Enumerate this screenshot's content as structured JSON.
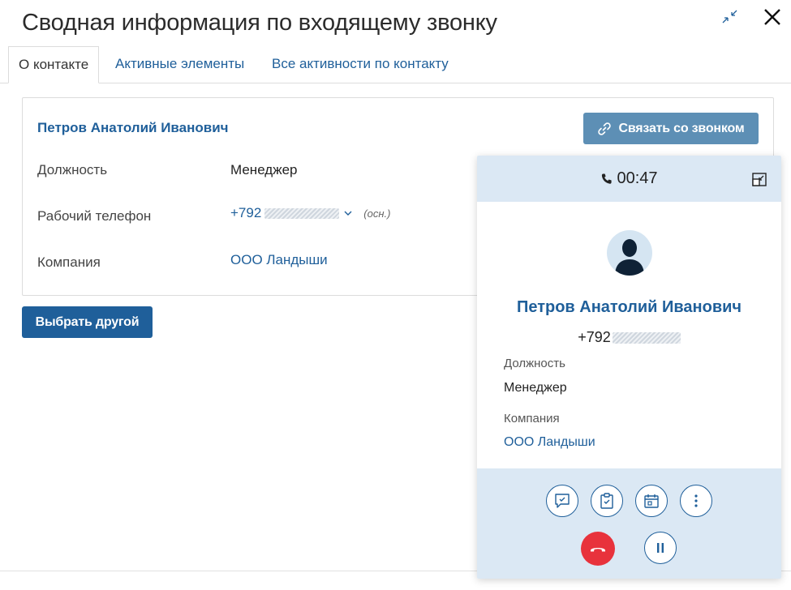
{
  "dialog": {
    "title": "Сводная информация по входящему звонку",
    "collapse_icon": "collapse-arrows-icon",
    "close_icon": "close-icon"
  },
  "tabs": [
    {
      "label": "О контакте",
      "active": true
    },
    {
      "label": "Активные элементы",
      "active": false
    },
    {
      "label": "Все активности по контакту",
      "active": false
    }
  ],
  "contact_card": {
    "name": "Петров Анатолий Иванович",
    "link_button_label": "Связать со звонком",
    "link_button_icon": "link-icon",
    "rows": {
      "position": {
        "label": "Должность",
        "value": "Менеджер"
      },
      "phone": {
        "label": "Рабочий телефон",
        "value": "+792",
        "note": "(осн.)"
      },
      "company": {
        "label": "Компания",
        "value": "ООО Ландыши"
      }
    }
  },
  "choose_button_label": "Выбрать другой",
  "call_panel": {
    "timer": "00:47",
    "name": "Петров Анатолий Иванович",
    "phone": "+792",
    "fields": {
      "position": {
        "label": "Должность",
        "value": "Менеджер"
      },
      "company": {
        "label": "Компания",
        "value": "ООО Ландыши"
      }
    },
    "actions": [
      "comment-icon",
      "task-icon",
      "calendar-icon",
      "more-icon"
    ],
    "controls": [
      "hangup-icon",
      "pause-icon"
    ]
  },
  "colors": {
    "accent": "#1f5f9a",
    "link_button": "#5d8fb5",
    "panel_bg": "#dbe8f4",
    "hangup": "#e8323c"
  }
}
